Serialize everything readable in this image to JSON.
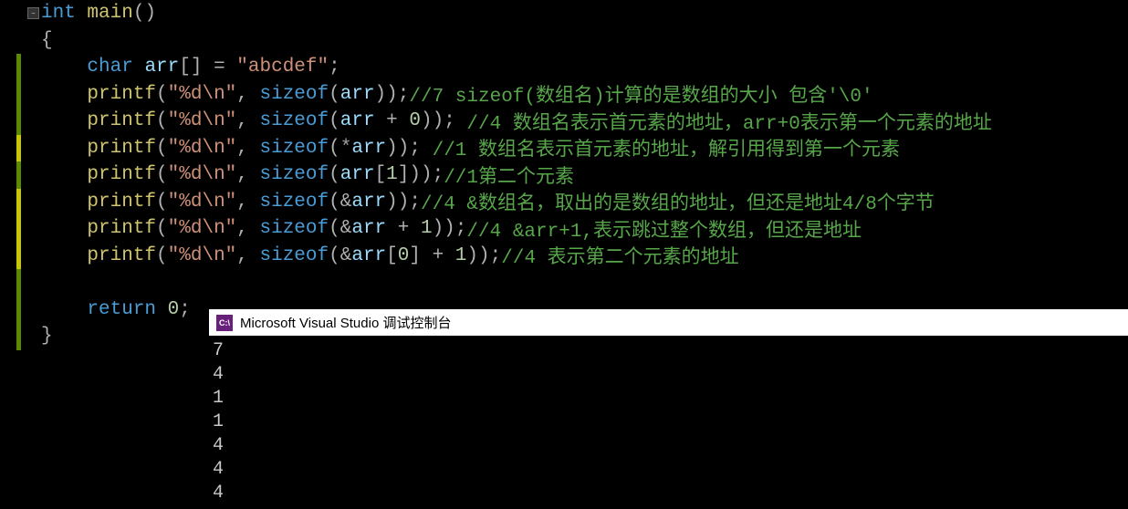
{
  "code": {
    "lines": [
      {
        "indent": 0,
        "segs": [
          {
            "c": "kw",
            "t": "int"
          },
          {
            "c": "op",
            "t": " "
          },
          {
            "c": "fn",
            "t": "main"
          },
          {
            "c": "paren",
            "t": "()"
          }
        ],
        "fold": true,
        "bar": "none"
      },
      {
        "indent": 0,
        "segs": [
          {
            "c": "brace",
            "t": "{"
          }
        ],
        "bar": "none"
      },
      {
        "indent": 1,
        "segs": [
          {
            "c": "kw",
            "t": "char"
          },
          {
            "c": "op",
            "t": " "
          },
          {
            "c": "idp",
            "t": "arr"
          },
          {
            "c": "paren",
            "t": "[]"
          },
          {
            "c": "op",
            "t": " = "
          },
          {
            "c": "str",
            "t": "\"abcdef\""
          },
          {
            "c": "semi",
            "t": ";"
          }
        ],
        "bar": "green"
      },
      {
        "indent": 1,
        "segs": [
          {
            "c": "fn",
            "t": "printf"
          },
          {
            "c": "paren",
            "t": "("
          },
          {
            "c": "str",
            "t": "\"%d\\n\""
          },
          {
            "c": "op",
            "t": ", "
          },
          {
            "c": "kw",
            "t": "sizeof"
          },
          {
            "c": "paren",
            "t": "("
          },
          {
            "c": "idp",
            "t": "arr"
          },
          {
            "c": "paren",
            "t": "))"
          },
          {
            "c": "semi",
            "t": ";"
          },
          {
            "c": "cmt",
            "t": "//7 sizeof(数组名)计算的是数组的大小 包含'\\0'"
          }
        ],
        "bar": "green"
      },
      {
        "indent": 1,
        "segs": [
          {
            "c": "fn",
            "t": "printf"
          },
          {
            "c": "paren",
            "t": "("
          },
          {
            "c": "str",
            "t": "\"%d\\n\""
          },
          {
            "c": "op",
            "t": ", "
          },
          {
            "c": "kw",
            "t": "sizeof"
          },
          {
            "c": "paren",
            "t": "("
          },
          {
            "c": "idp",
            "t": "arr"
          },
          {
            "c": "op",
            "t": " + "
          },
          {
            "c": "num",
            "t": "0"
          },
          {
            "c": "paren",
            "t": "))"
          },
          {
            "c": "semi",
            "t": ";"
          },
          {
            "c": "op",
            "t": " "
          },
          {
            "c": "cmt",
            "t": "//4 数组名表示首元素的地址，arr+0表示第一个元素的地址"
          }
        ],
        "bar": "green"
      },
      {
        "indent": 1,
        "segs": [
          {
            "c": "fn",
            "t": "printf"
          },
          {
            "c": "paren",
            "t": "("
          },
          {
            "c": "str",
            "t": "\"%d\\n\""
          },
          {
            "c": "op",
            "t": ", "
          },
          {
            "c": "kw",
            "t": "sizeof"
          },
          {
            "c": "paren",
            "t": "("
          },
          {
            "c": "opstar",
            "t": "*"
          },
          {
            "c": "idp",
            "t": "arr"
          },
          {
            "c": "paren",
            "t": "))"
          },
          {
            "c": "semi",
            "t": ";"
          },
          {
            "c": "op",
            "t": " "
          },
          {
            "c": "cmt",
            "t": "//1 数组名表示首元素的地址，解引用得到第一个元素"
          }
        ],
        "bar": "yellow"
      },
      {
        "indent": 1,
        "segs": [
          {
            "c": "fn",
            "t": "printf"
          },
          {
            "c": "paren",
            "t": "("
          },
          {
            "c": "str",
            "t": "\"%d\\n\""
          },
          {
            "c": "op",
            "t": ", "
          },
          {
            "c": "kw",
            "t": "sizeof"
          },
          {
            "c": "paren",
            "t": "("
          },
          {
            "c": "idp",
            "t": "arr"
          },
          {
            "c": "paren",
            "t": "["
          },
          {
            "c": "num",
            "t": "1"
          },
          {
            "c": "paren",
            "t": "]))"
          },
          {
            "c": "semi",
            "t": ";"
          },
          {
            "c": "cmt",
            "t": "//1第二个元素"
          }
        ],
        "bar": "green"
      },
      {
        "indent": 1,
        "segs": [
          {
            "c": "fn",
            "t": "printf"
          },
          {
            "c": "paren",
            "t": "("
          },
          {
            "c": "str",
            "t": "\"%d\\n\""
          },
          {
            "c": "op",
            "t": ", "
          },
          {
            "c": "kw",
            "t": "sizeof"
          },
          {
            "c": "paren",
            "t": "("
          },
          {
            "c": "op",
            "t": "&"
          },
          {
            "c": "idp",
            "t": "arr"
          },
          {
            "c": "paren",
            "t": "))"
          },
          {
            "c": "semi",
            "t": ";"
          },
          {
            "c": "cmt",
            "t": "//4 &数组名，取出的是数组的地址，但还是地址4/8个字节"
          }
        ],
        "bar": "yellow"
      },
      {
        "indent": 1,
        "segs": [
          {
            "c": "fn",
            "t": "printf"
          },
          {
            "c": "paren",
            "t": "("
          },
          {
            "c": "str",
            "t": "\"%d\\n\""
          },
          {
            "c": "op",
            "t": ", "
          },
          {
            "c": "kw",
            "t": "sizeof"
          },
          {
            "c": "paren",
            "t": "("
          },
          {
            "c": "op",
            "t": "&"
          },
          {
            "c": "idp",
            "t": "arr"
          },
          {
            "c": "op",
            "t": " + "
          },
          {
            "c": "num",
            "t": "1"
          },
          {
            "c": "paren",
            "t": "))"
          },
          {
            "c": "semi",
            "t": ";"
          },
          {
            "c": "cmt",
            "t": "//4 &arr+1,表示跳过整个数组，但还是地址"
          }
        ],
        "bar": "yellow"
      },
      {
        "indent": 1,
        "segs": [
          {
            "c": "fn",
            "t": "printf"
          },
          {
            "c": "paren",
            "t": "("
          },
          {
            "c": "str",
            "t": "\"%d\\n\""
          },
          {
            "c": "op",
            "t": ", "
          },
          {
            "c": "kw",
            "t": "sizeof"
          },
          {
            "c": "paren",
            "t": "("
          },
          {
            "c": "op",
            "t": "&"
          },
          {
            "c": "idp",
            "t": "arr"
          },
          {
            "c": "paren",
            "t": "["
          },
          {
            "c": "num",
            "t": "0"
          },
          {
            "c": "paren",
            "t": "]"
          },
          {
            "c": "op",
            "t": " + "
          },
          {
            "c": "num",
            "t": "1"
          },
          {
            "c": "paren",
            "t": "))"
          },
          {
            "c": "semi",
            "t": ";"
          },
          {
            "c": "cmt",
            "t": "//4 表示第二个元素的地址"
          }
        ],
        "bar": "yellow"
      },
      {
        "indent": 1,
        "segs": [],
        "bar": "green"
      },
      {
        "indent": 1,
        "segs": [
          {
            "c": "kw",
            "t": "return"
          },
          {
            "c": "op",
            "t": " "
          },
          {
            "c": "num",
            "t": "0"
          },
          {
            "c": "semi",
            "t": ";"
          }
        ],
        "bar": "green"
      },
      {
        "indent": 0,
        "segs": [
          {
            "c": "brace",
            "t": "}"
          }
        ],
        "bar": "green"
      }
    ]
  },
  "console": {
    "title": "Microsoft Visual Studio 调试控制台",
    "icon_text": "C:\\",
    "output": [
      "7",
      "4",
      "1",
      "1",
      "4",
      "4",
      "4"
    ]
  }
}
